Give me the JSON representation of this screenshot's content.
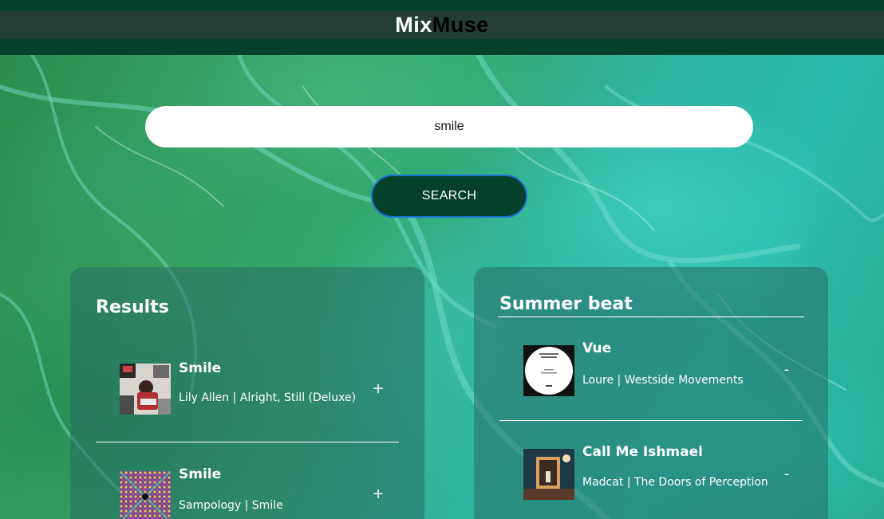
{
  "header": {
    "logo_part1": "Mix",
    "logo_part2": "Muse"
  },
  "search": {
    "value": "smile",
    "button_label": "SEARCH"
  },
  "results": {
    "title": "Results",
    "tracks": [
      {
        "name": "Smile",
        "meta": "Lily Allen | Alright, Still (Deluxe)",
        "action": "+"
      },
      {
        "name": "Smile",
        "meta": "Sampology | Smile",
        "action": "+"
      }
    ]
  },
  "playlist": {
    "title": "Summer beat",
    "tracks": [
      {
        "name": "Vue",
        "meta": "Loure | Westside Movements",
        "action": "-"
      },
      {
        "name": "Call Me Ishmael",
        "meta": "Madcat | The Doors of Perception",
        "action": "-"
      }
    ]
  },
  "colors": {
    "header_dark": "#05402a",
    "nav_bar": "#233f33",
    "button_bg": "#05402a",
    "button_border": "#1b6fd6"
  }
}
